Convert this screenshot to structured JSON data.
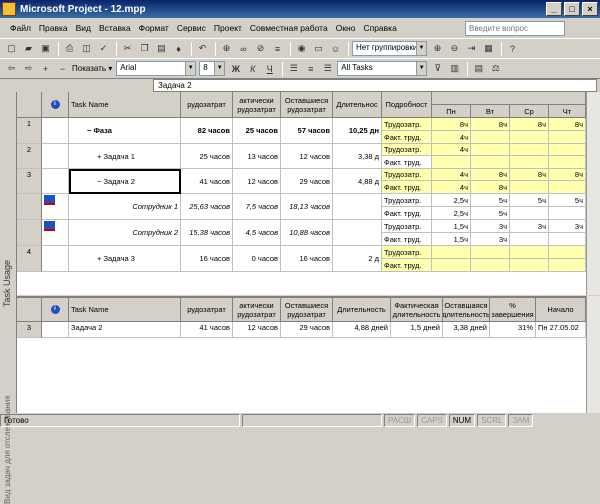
{
  "window": {
    "title": "Microsoft Project - 12.mpp",
    "min": "_",
    "max": "□",
    "close": "×"
  },
  "menu": [
    "Файл",
    "Правка",
    "Вид",
    "Вставка",
    "Формат",
    "Сервис",
    "Проект",
    "Совместная работа",
    "Окно",
    "Справка"
  ],
  "ask_placeholder": "Введите вопрос",
  "toolbar": {
    "grouping": "Нет группировки",
    "show": "Показать",
    "font": "Arial",
    "size": "8",
    "bold": "Ж",
    "italic": "К",
    "underline": "Ч",
    "filter": "All Tasks"
  },
  "entry": "Задача 2",
  "view_label": "Task Usage",
  "lower_view_label": "Вид задач для отслеживания",
  "upper": {
    "headers": [
      "Task Name",
      "Трудозатраты",
      "Фактические трудозатраты",
      "Оставшиеся трудозатраты",
      "Длительность",
      "Подробности"
    ],
    "headers_short": [
      "Task Name",
      "рудозатрат",
      "актически рудозатрат",
      "Оставшиеся рудозатрат",
      "Длительнос",
      "Подробност"
    ],
    "days": [
      "Пн",
      "Вт",
      "Ср",
      "Чт"
    ],
    "rows": [
      {
        "id": "1",
        "name": "− Фаза",
        "work": "82 часов",
        "act": "25 часов",
        "rem": "57 часов",
        "dur": "10,25 дн",
        "bold": true,
        "det": [
          [
            "Трудозатр.",
            "8ч",
            "8ч",
            "8ч",
            "8ч"
          ],
          [
            "Факт. труд.",
            "4ч",
            "",
            "",
            ""
          ]
        ]
      },
      {
        "id": "2",
        "name": "+ Задача 1",
        "work": "25 часов",
        "act": "13 часов",
        "rem": "12 часов",
        "dur": "3,38 д",
        "det": [
          [
            "Трудозатр.",
            "4ч",
            "",
            "",
            ""
          ],
          [
            "Факт. труд.",
            "",
            "",
            "",
            ""
          ]
        ]
      },
      {
        "id": "3",
        "name": "− Задача 2",
        "work": "41 часов",
        "act": "12 часов",
        "rem": "29 часов",
        "dur": "4,88 д",
        "det": [
          [
            "Трудозатр.",
            "4ч",
            "8ч",
            "8ч",
            "8ч"
          ],
          [
            "Факт. труд.",
            "4ч",
            "8ч",
            "",
            ""
          ]
        ]
      },
      {
        "id": "",
        "name": "Сотрудник 1",
        "work": "25,63 часов",
        "act": "7,5 часов",
        "rem": "18,13 часов",
        "dur": "",
        "det": [
          [
            "Трудозатр.",
            "2,5ч",
            "5ч",
            "5ч",
            "5ч"
          ],
          [
            "Факт. труд.",
            "2,5ч",
            "5ч",
            "",
            ""
          ]
        ]
      },
      {
        "id": "",
        "name": "Сотрудник 2",
        "work": "15,38 часов",
        "act": "4,5 часов",
        "rem": "10,88 часов",
        "dur": "",
        "det": [
          [
            "Трудозатр.",
            "1,5ч",
            "3ч",
            "3ч",
            "3ч"
          ],
          [
            "Факт. труд.",
            "1,5ч",
            "3ч",
            "",
            ""
          ]
        ]
      },
      {
        "id": "4",
        "name": "+ Задача 3",
        "work": "16 часов",
        "act": "0 часов",
        "rem": "16 часов",
        "dur": "2 д",
        "det": [
          [
            "Трудозатр.",
            "",
            "",
            "",
            ""
          ],
          [
            "Факт. труд.",
            "",
            "",
            "",
            ""
          ]
        ]
      }
    ]
  },
  "lower": {
    "headers": [
      "Task Name",
      "Трудозатраты",
      "Фактические трудозатраты",
      "Оставшиеся трудозатраты",
      "Длительность",
      "Фактическая длительность",
      "Оставшаяся длительность",
      "% завершения",
      "Начало"
    ],
    "headers_short": [
      "Task Name",
      "рудозатрат",
      "актически рудозатрат",
      "Оставшиеся рудозатрат",
      "Длительность",
      "Фактическая длительность",
      "Оставшаяся длительность",
      "% завершения",
      "Начало"
    ],
    "row": {
      "id": "3",
      "name": "Задача 2",
      "work": "41 часов",
      "act": "12 часов",
      "rem": "29 часов",
      "dur": "4,88 дней",
      "actdur": "1,5 дней",
      "remdur": "3,38 дней",
      "pct": "31%",
      "start": "Пн 27.05.02"
    }
  },
  "status": {
    "ready": "Готово",
    "items": [
      "РАСШ",
      "CAPS",
      "NUM",
      "SCRL",
      "ЗАМ"
    ]
  }
}
